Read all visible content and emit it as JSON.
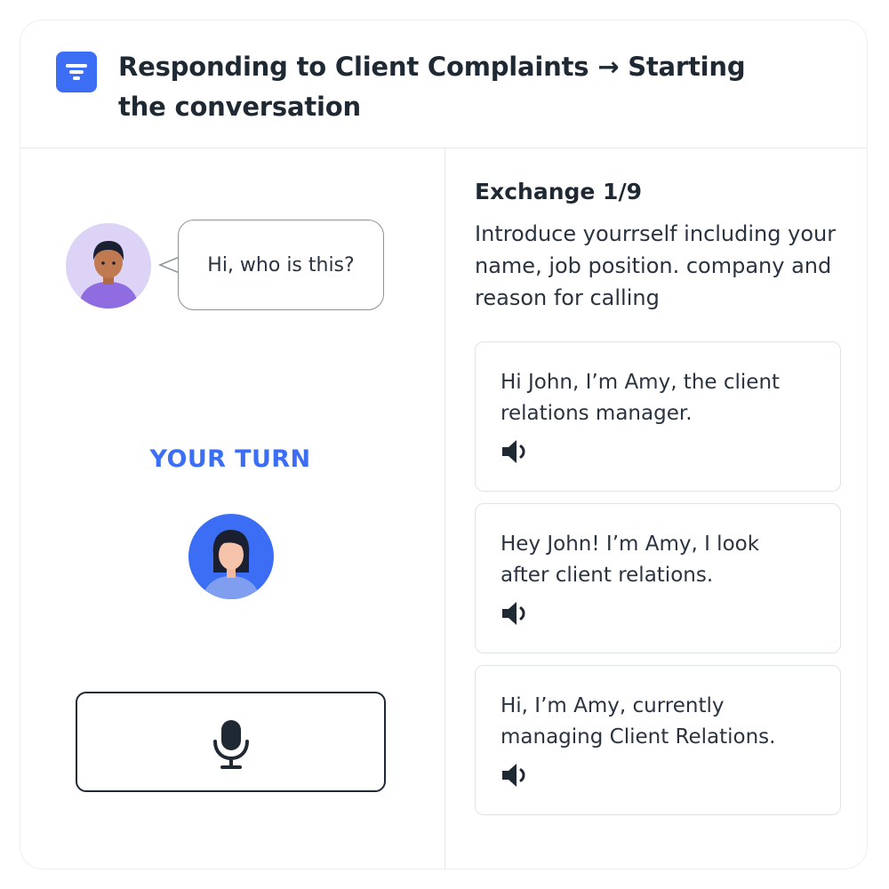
{
  "header": {
    "icon": "menu-filter-icon",
    "title": "Responding to Client Complaints → Starting the conversation"
  },
  "conversation": {
    "partner_avatar": "man-avatar",
    "partner_message": "Hi, who is this?",
    "turn_label": "YOUR TURN",
    "user_avatar": "woman-avatar",
    "record_button_icon": "microphone-icon"
  },
  "exchange": {
    "title": "Exchange 1/9",
    "instruction": "Introduce yourrself including your name, job position. company and reason for calling",
    "options": [
      {
        "text": "Hi John, I’m Amy, the client relations manager.",
        "icon": "speaker-icon"
      },
      {
        "text": "Hey John! I’m Amy, I look after client relations.",
        "icon": "speaker-icon"
      },
      {
        "text": "Hi, I’m Amy, currently managing Client Relations.",
        "icon": "speaker-icon"
      }
    ]
  },
  "colors": {
    "accent": "#3b6ef5",
    "text": "#1f2933",
    "border": "#dfe3e8",
    "partner_avatar_bg": "#ddd3f6"
  }
}
